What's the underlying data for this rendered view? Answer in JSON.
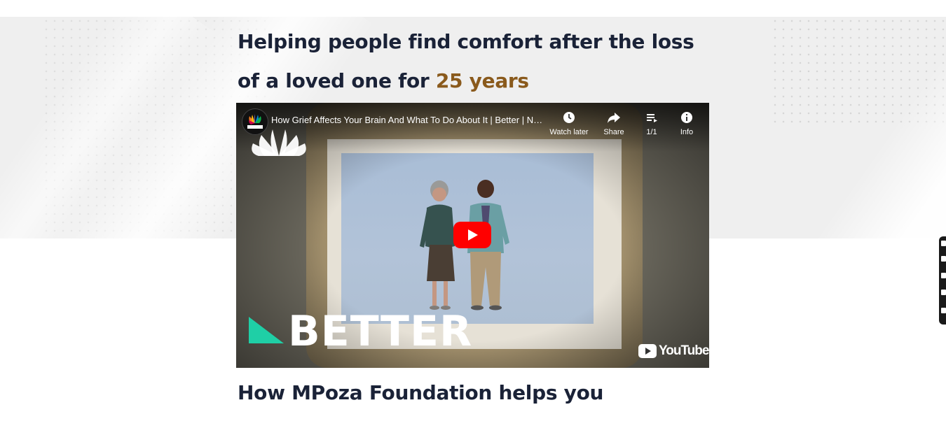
{
  "hero": {
    "headline_part1": "Helping people find comfort after the loss of a loved one for ",
    "headline_accent": "25 years",
    "accent_color": "#8a5a1c",
    "text_color": "#1a2237"
  },
  "video": {
    "channel": "NBC NEWS",
    "title": "How Grief Affects Your Brain And What To Do About It | Better | NBC News",
    "actions": [
      {
        "label": "Watch later",
        "icon": "clock-icon"
      },
      {
        "label": "Share",
        "icon": "share-arrow-icon"
      },
      {
        "label": "1/1",
        "icon": "playlist-icon"
      },
      {
        "label": "Info",
        "icon": "info-icon"
      }
    ],
    "overlay_brand": "BETTER",
    "player_brand": "YouTube",
    "play_color": "#ff0000",
    "brand_accent": "#1fcfa6"
  },
  "section": {
    "heading": "How MPoza Foundation helps you",
    "partial_text": "... ... ... ... ..."
  }
}
